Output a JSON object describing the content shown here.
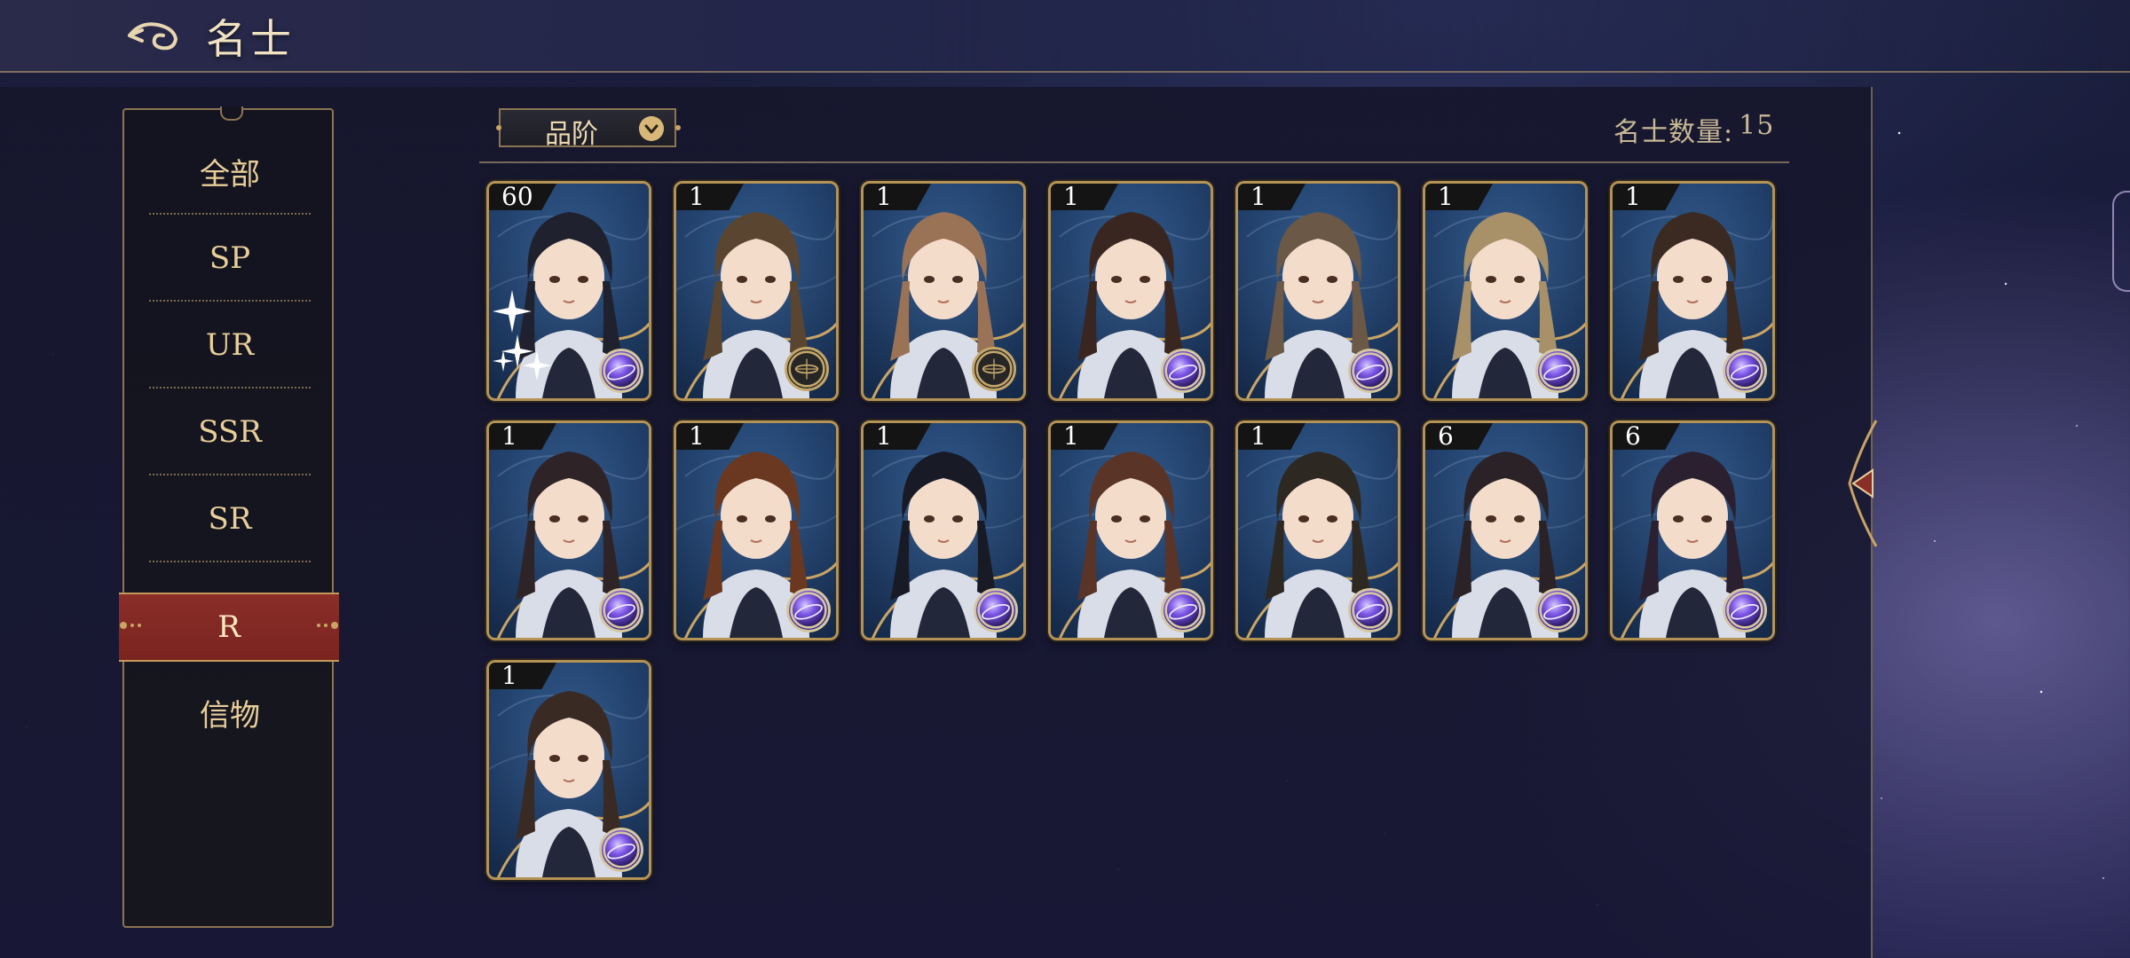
{
  "header": {
    "title": "名士"
  },
  "sidebar": {
    "items": [
      {
        "label": "全部"
      },
      {
        "label": "SP"
      },
      {
        "label": "UR"
      },
      {
        "label": "SSR"
      },
      {
        "label": "SR"
      },
      {
        "label": "R",
        "active": true
      },
      {
        "label": "信物"
      }
    ]
  },
  "filter": {
    "label": "品阶"
  },
  "count": {
    "label": "名士数量:",
    "value": "15"
  },
  "colors": {
    "accent_gold": "#b49355",
    "active_tab": "#8a2e28",
    "text_gold": "#e8cf9a"
  },
  "cards": [
    {
      "level": "60",
      "hair": "#20212e",
      "badge": "orb",
      "sparkle": true
    },
    {
      "level": "1",
      "hair": "#5a4530",
      "badge": "compass"
    },
    {
      "level": "1",
      "hair": "#9a7356",
      "badge": "compass"
    },
    {
      "level": "1",
      "hair": "#3a2620",
      "badge": "orb"
    },
    {
      "level": "1",
      "hair": "#6b5847",
      "badge": "orb"
    },
    {
      "level": "1",
      "hair": "#a89068",
      "badge": "orb"
    },
    {
      "level": "1",
      "hair": "#3a2a22",
      "badge": "orb"
    },
    {
      "level": "1",
      "hair": "#2e2428",
      "badge": "orb"
    },
    {
      "level": "1",
      "hair": "#6a3820",
      "badge": "orb"
    },
    {
      "level": "1",
      "hair": "#181a26",
      "badge": "orb"
    },
    {
      "level": "1",
      "hair": "#5a3426",
      "badge": "orb"
    },
    {
      "level": "1",
      "hair": "#2e2822",
      "badge": "orb"
    },
    {
      "level": "6",
      "hair": "#2a2226",
      "badge": "orb"
    },
    {
      "level": "6",
      "hair": "#2a2030",
      "badge": "orb"
    },
    {
      "level": "1",
      "hair": "#3a2a24",
      "badge": "orb"
    }
  ]
}
